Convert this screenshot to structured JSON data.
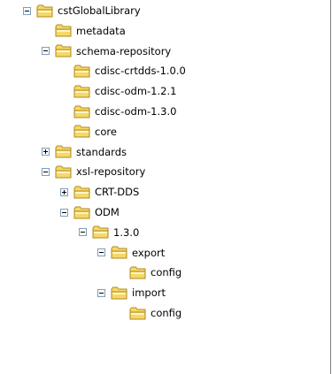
{
  "tree": [
    {
      "label": "cstGlobalLibrary",
      "depth": 0,
      "toggle": "collapse"
    },
    {
      "label": "metadata",
      "depth": 1,
      "toggle": "none"
    },
    {
      "label": "schema-repository",
      "depth": 1,
      "toggle": "collapse"
    },
    {
      "label": "cdisc-crtdds-1.0.0",
      "depth": 2,
      "toggle": "none"
    },
    {
      "label": "cdisc-odm-1.2.1",
      "depth": 2,
      "toggle": "none"
    },
    {
      "label": "cdisc-odm-1.3.0",
      "depth": 2,
      "toggle": "none"
    },
    {
      "label": "core",
      "depth": 2,
      "toggle": "none"
    },
    {
      "label": "standards",
      "depth": 1,
      "toggle": "expand"
    },
    {
      "label": "xsl-repository",
      "depth": 1,
      "toggle": "collapse"
    },
    {
      "label": "CRT-DDS",
      "depth": 2,
      "toggle": "expand"
    },
    {
      "label": "ODM",
      "depth": 2,
      "toggle": "collapse"
    },
    {
      "label": "1.3.0",
      "depth": 3,
      "toggle": "collapse"
    },
    {
      "label": "export",
      "depth": 4,
      "toggle": "collapse"
    },
    {
      "label": "config",
      "depth": 5,
      "toggle": "none"
    },
    {
      "label": "import",
      "depth": 4,
      "toggle": "collapse"
    },
    {
      "label": "config",
      "depth": 5,
      "toggle": "none"
    }
  ],
  "colors": {
    "folder_fill": "#f6d86a",
    "folder_light": "#fff6c8",
    "folder_outline": "#b08a1c",
    "expander_border": "#7f9db9"
  },
  "icons": {
    "folder": "folder-icon",
    "expand": "plus-icon",
    "collapse": "minus-icon"
  }
}
